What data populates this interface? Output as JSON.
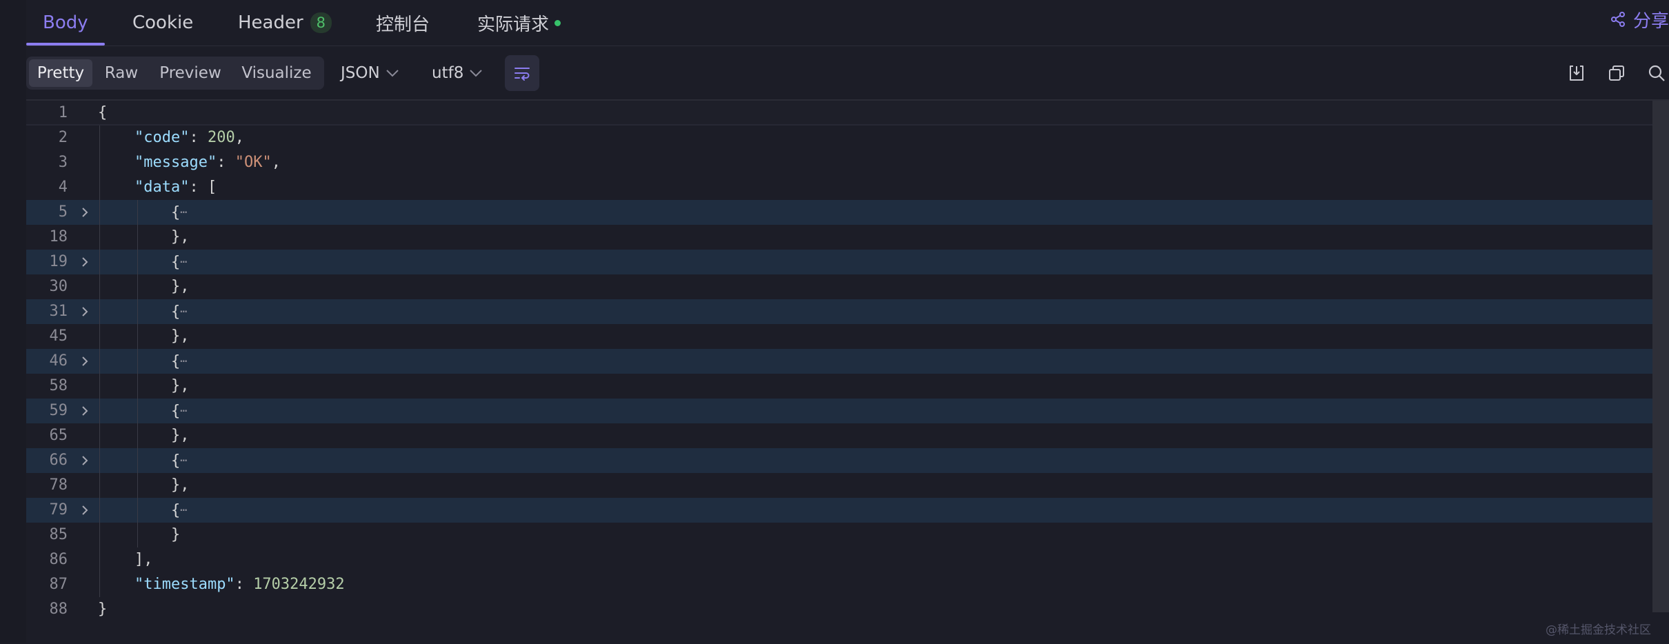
{
  "tabs": [
    {
      "label": "Body"
    },
    {
      "label": "Cookie"
    },
    {
      "label": "Header",
      "badge": "8"
    },
    {
      "label": "控制台"
    },
    {
      "label": "实际请求"
    }
  ],
  "share_label": "分享",
  "view_modes": [
    "Pretty",
    "Raw",
    "Preview",
    "Visualize"
  ],
  "format_select": "JSON",
  "encoding_select": "utf8",
  "line_numbers": [
    "1",
    "2",
    "3",
    "4",
    "5",
    "18",
    "19",
    "30",
    "31",
    "45",
    "46",
    "58",
    "59",
    "65",
    "66",
    "78",
    "79",
    "85",
    "86",
    "87",
    "88"
  ],
  "code": {
    "open_brace": "{",
    "close_brace": "}",
    "code_key": "\"code\"",
    "code_value": "200",
    "message_key": "\"message\"",
    "message_value": "\"OK\"",
    "data_key": "\"data\"",
    "timestamp_key": "\"timestamp\"",
    "timestamp_value": "1703242932"
  },
  "watermark": "@稀土掘金技术社区",
  "colors": {
    "accent": "#8c7df0",
    "badge_green": "#4fc06a",
    "json_key": "#9cdcfe",
    "json_number": "#b5cea8",
    "json_string": "#ce9178",
    "folded_line_highlight": "#1f2d40"
  }
}
